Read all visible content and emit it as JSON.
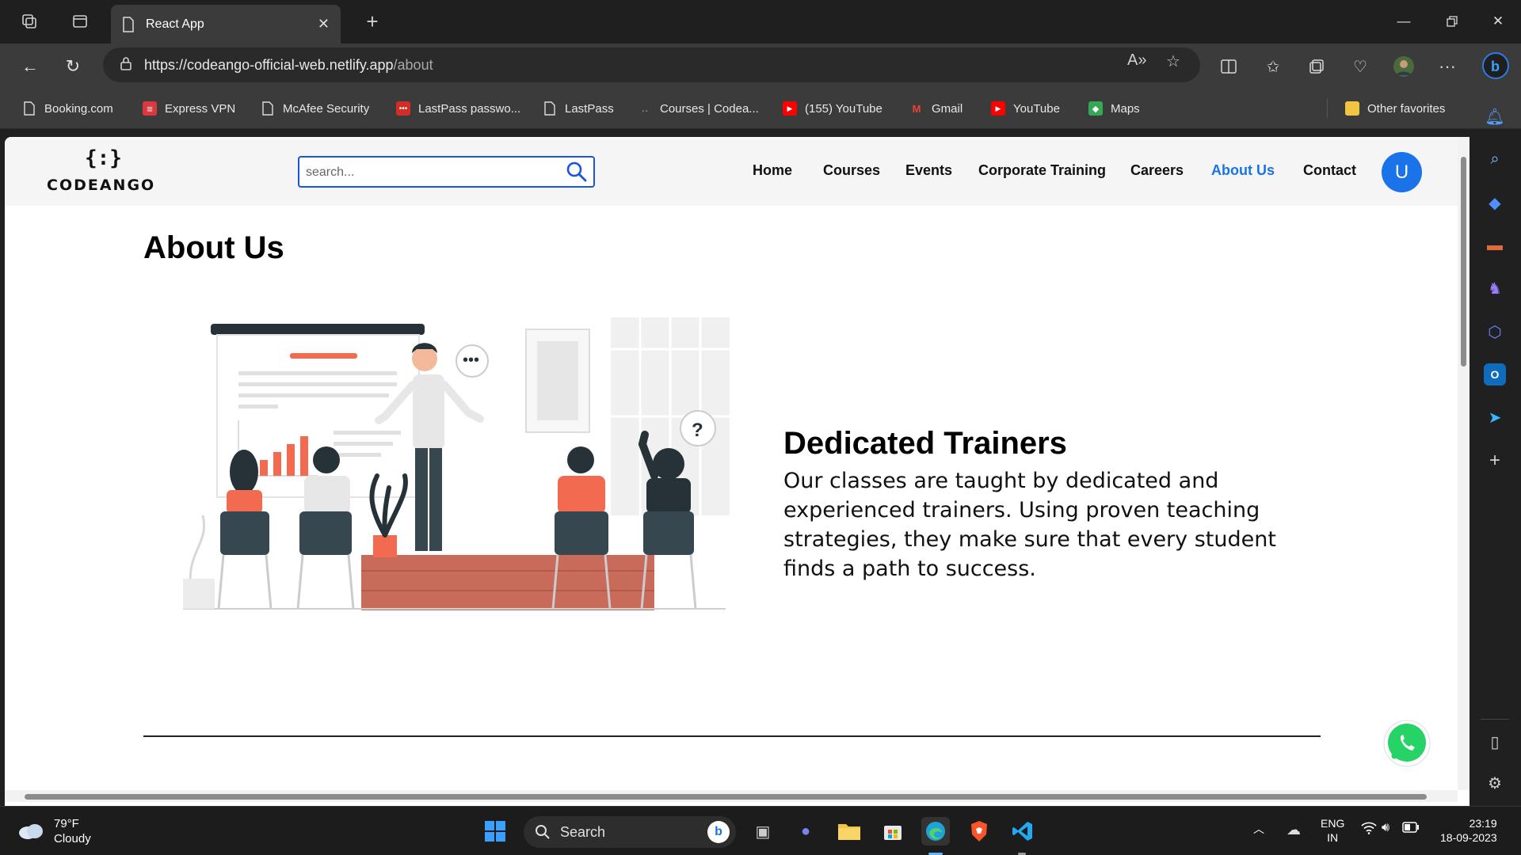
{
  "browser": {
    "tab_title": "React App",
    "url_host": "https://codeango-official-web.netlify.app",
    "url_path": "/about",
    "favorites": [
      {
        "label": "Booking.com",
        "icon": "page-icon"
      },
      {
        "label": "Express VPN",
        "icon": "expressvpn-icon"
      },
      {
        "label": "McAfee Security",
        "icon": "page-icon"
      },
      {
        "label": "LastPass passwo...",
        "icon": "lastpass-icon"
      },
      {
        "label": "LastPass",
        "icon": "page-icon"
      },
      {
        "label": "Courses | Codea...",
        "icon": "codeango-icon"
      },
      {
        "label": "(155) YouTube",
        "icon": "youtube-icon"
      },
      {
        "label": "Gmail",
        "icon": "gmail-icon"
      },
      {
        "label": "YouTube",
        "icon": "youtube-icon"
      },
      {
        "label": "Maps",
        "icon": "maps-icon"
      }
    ],
    "other_favorites": "Other favorites"
  },
  "site": {
    "logo_text": "CODEANGO",
    "logo_mark": "{:}",
    "search_placeholder": "search...",
    "nav": [
      "Home",
      "Courses",
      "Events",
      "Corporate Training",
      "Careers",
      "About Us",
      "Contact"
    ],
    "active_nav": "About Us",
    "avatar_letter": "U",
    "accent_color": "#1a73e8"
  },
  "page": {
    "title": "About Us",
    "feature_title": "Dedicated Trainers",
    "feature_text": "Our classes are taught by dedicated and experienced trainers. Using proven teaching strategies, they make sure that every student finds a path to success."
  },
  "taskbar": {
    "temperature": "79°F",
    "weather": "Cloudy",
    "search_label": "Search",
    "language": "ENG",
    "region": "IN",
    "time": "23:19",
    "date": "18-09-2023"
  }
}
